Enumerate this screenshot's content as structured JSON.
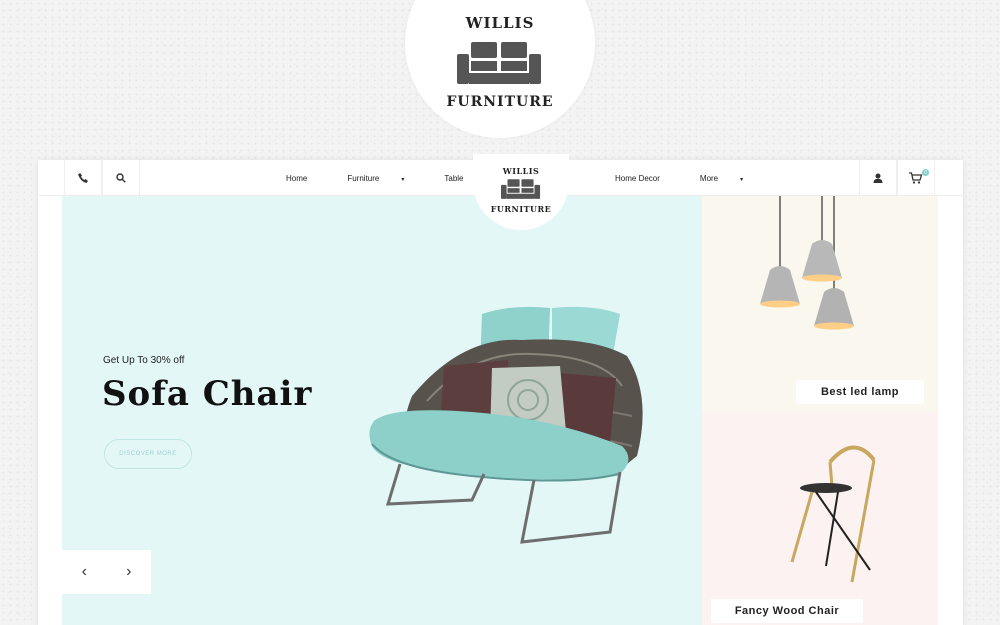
{
  "brand": {
    "line1": "WILLIS",
    "line2": "FURNITURE"
  },
  "header": {
    "nav": [
      {
        "label": "Home",
        "has_dropdown": false
      },
      {
        "label": "Furniture",
        "has_dropdown": true
      },
      {
        "label": "Table",
        "has_dropdown": true
      },
      {
        "label": "Home Decor",
        "has_dropdown": false
      },
      {
        "label": "More",
        "has_dropdown": true
      }
    ],
    "icons": [
      "phone-icon",
      "search-icon",
      "user-icon",
      "cart-icon"
    ],
    "cart_count": "0"
  },
  "hero": {
    "pretitle": "Get Up To 30% off",
    "title": "Sofa Chair",
    "button": "DISCOVER MORE",
    "prev_arrow": "‹",
    "next_arrow": "›"
  },
  "banners": [
    {
      "label": "Best led lamp"
    },
    {
      "label": "Fancy Wood Chair"
    }
  ],
  "colors": {
    "hero_bg": "#e4f7f7",
    "banner1_bg": "#faf7ee",
    "banner2_bg": "#fbf2f1",
    "accent": "#7ecfca"
  }
}
